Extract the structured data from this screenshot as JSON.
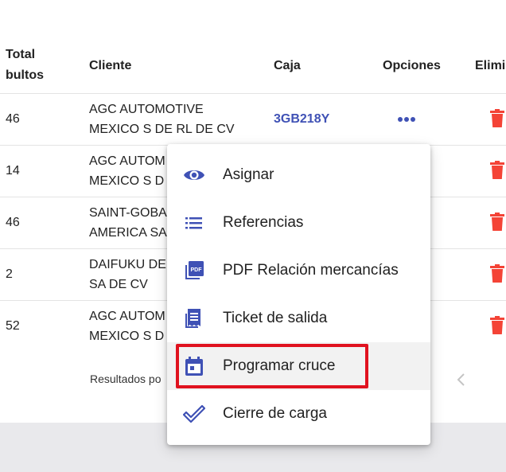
{
  "table": {
    "headers": {
      "total_line1": "Total",
      "total_line2": "bultos",
      "cliente": "Cliente",
      "caja": "Caja",
      "opciones": "Opciones",
      "eliminar": "Elimi"
    },
    "rows": [
      {
        "total": "46",
        "cliente_l1": "AGC AUTOMOTIVE",
        "cliente_l2": "MEXICO S DE RL DE CV",
        "caja": "3GB218Y"
      },
      {
        "total": "14",
        "cliente_l1": "AGC AUTOM",
        "cliente_l2": "MEXICO S D",
        "caja": ""
      },
      {
        "total": "46",
        "cliente_l1": "SAINT-GOBA",
        "cliente_l2": "AMERICA SA",
        "caja": ""
      },
      {
        "total": "2",
        "cliente_l1": "DAIFUKU DE",
        "cliente_l2": "SA DE CV",
        "caja": ""
      },
      {
        "total": "52",
        "cliente_l1": "AGC AUTOM",
        "cliente_l2": "MEXICO S D",
        "caja": ""
      }
    ],
    "footer": "Resultados po"
  },
  "menu": {
    "items": [
      {
        "label": "Asignar",
        "icon": "eye-icon"
      },
      {
        "label": "Referencias",
        "icon": "list-icon"
      },
      {
        "label": "PDF Relación mercancías",
        "icon": "pdf-icon"
      },
      {
        "label": "Ticket de salida",
        "icon": "receipt-icon"
      },
      {
        "label": "Programar cruce",
        "icon": "calendar-icon"
      },
      {
        "label": "Cierre de carga",
        "icon": "check-icon"
      }
    ],
    "highlighted_index": 4
  },
  "colors": {
    "accent": "#3f51b5",
    "delete": "#f44336",
    "highlight_border": "#e0121f"
  }
}
